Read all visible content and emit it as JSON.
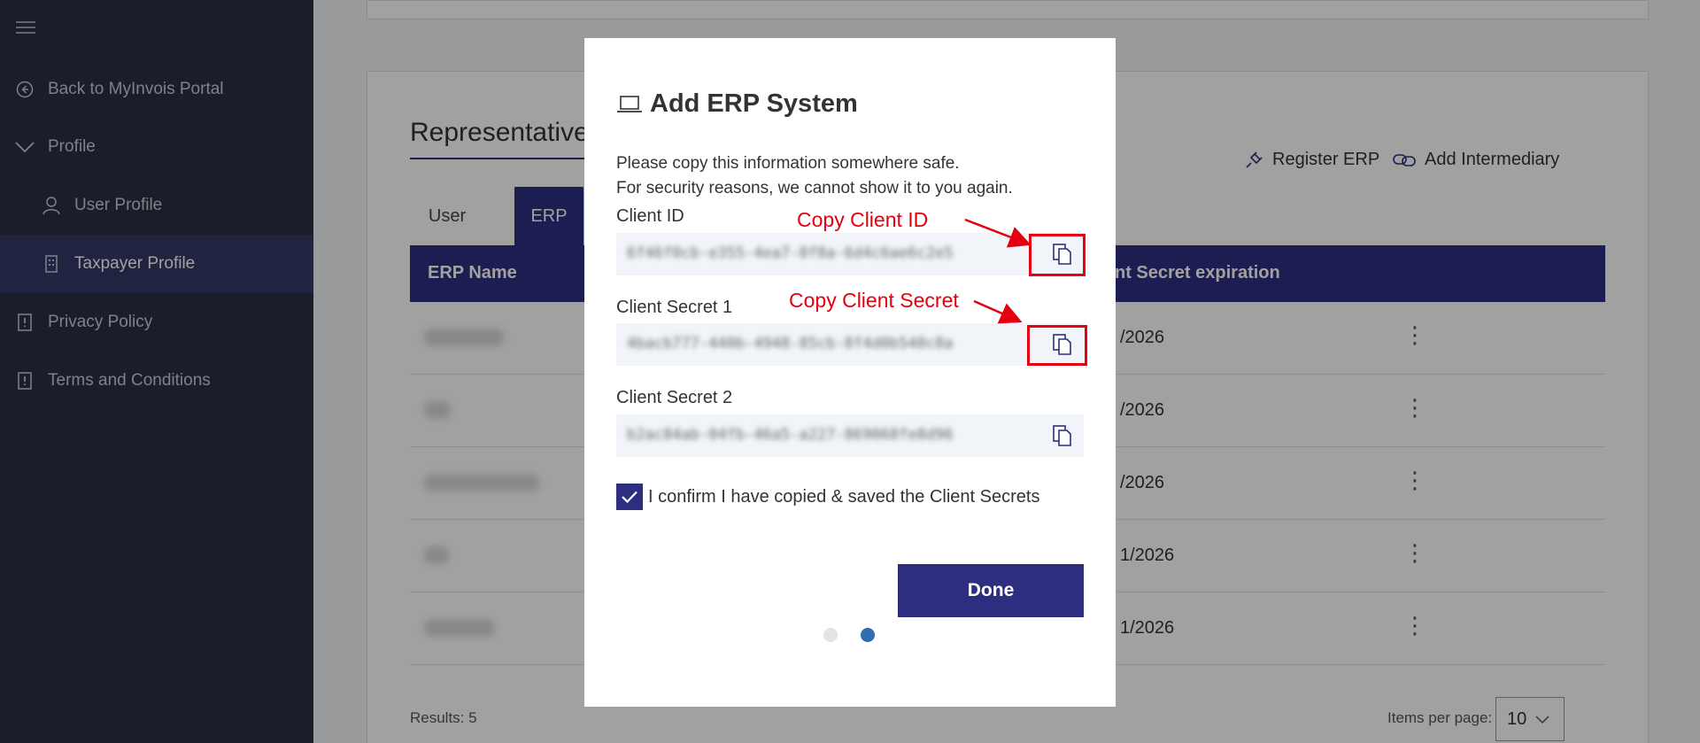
{
  "sidebar": {
    "items": [
      {
        "label": "Back to MyInvois Portal",
        "icon": "arrow-left-circle-icon"
      },
      {
        "label": "Profile",
        "icon": "chevron-down-icon"
      },
      {
        "label": "User Profile",
        "icon": "user-icon"
      },
      {
        "label": "Taxpayer Profile",
        "icon": "building-icon"
      },
      {
        "label": "Privacy Policy",
        "icon": "document-icon"
      },
      {
        "label": "Terms and Conditions",
        "icon": "document-icon"
      }
    ]
  },
  "main": {
    "section_title": "Representatives",
    "tabs": [
      {
        "label": "User"
      },
      {
        "label": "ERP"
      }
    ],
    "actions": [
      {
        "label": "Register ERP",
        "icon": "plug-icon"
      },
      {
        "label": "Add Intermediary",
        "icon": "link-icon"
      }
    ],
    "table": {
      "columns": [
        "ERP Name",
        "nt Secret expiration"
      ],
      "rows": [
        {
          "date": "/2026"
        },
        {
          "date": "/2026"
        },
        {
          "date": "/2026"
        },
        {
          "date": "1/2026"
        },
        {
          "date": "1/2026"
        }
      ]
    },
    "results": "Results: 5",
    "items_per_page_label": "Items per page:",
    "items_per_page_value": "10"
  },
  "modal": {
    "title": "Add ERP System",
    "title_icon": "laptop-icon",
    "desc_line1": "Please copy this information somewhere safe.",
    "desc_line2": "For security reasons, we cannot show it to you again.",
    "fields": [
      {
        "label": "Client ID",
        "value": "6f46f0cb-e355-4ea7-8f8a-6d4c6ae6c2e5"
      },
      {
        "label": "Client Secret 1",
        "value": "4bacb777-440b-4948-85cb-8f4d0b540c8a"
      },
      {
        "label": "Client Secret 2",
        "value": "b2ac84ab-04fb-46a5-a227-869068fe8d96"
      }
    ],
    "confirm_label": "I confirm I have copied & saved the Client Secrets",
    "done_label": "Done"
  },
  "annotations": {
    "copy_client_id": "Copy Client ID",
    "copy_client_secret": "Copy Client Secret",
    "color": "#e4000f"
  },
  "colors": {
    "primary": "#2d2e7f",
    "sidebar_bg": "#2b2f44",
    "active_dot": "#2f6cb0"
  }
}
